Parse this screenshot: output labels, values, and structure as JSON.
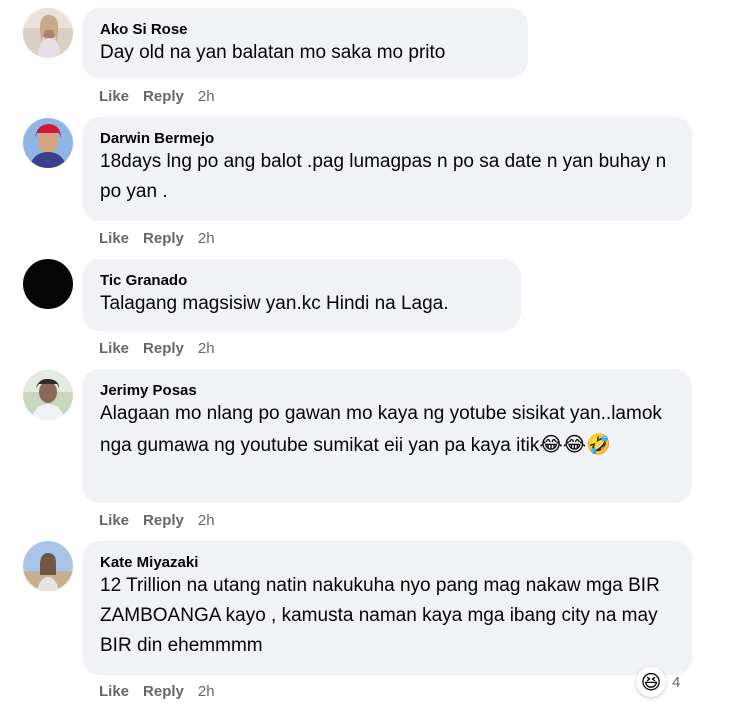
{
  "comments": [
    {
      "name": "Ako Si Rose",
      "text": "Day old na yan balatan mo saka mo prito",
      "like": "Like",
      "reply": "Reply",
      "time": "2h"
    },
    {
      "name": "Darwin Bermejo",
      "text": "18days lng po ang balot .pag lumagpas n po sa date n yan buhay n po yan .",
      "like": "Like",
      "reply": "Reply",
      "time": "2h"
    },
    {
      "name": "Tic Granado",
      "text": "Talagang magsisiw yan.kc Hindi na Laga.",
      "like": "Like",
      "reply": "Reply",
      "time": "2h"
    },
    {
      "name": "Jerimy Posas",
      "text": "Alagaan mo nlang po gawan mo kaya ng yotube sisikat yan..lamok nga gumawa ng youtube sumikat eii yan pa kaya itik",
      "emojis": "😂😂🤣",
      "like": "Like",
      "reply": "Reply",
      "time": "2h"
    },
    {
      "name": "Kate Miyazaki",
      "text": "12 Trillion na utang natin nakukuha nyo pang mag nakaw mga BIR ZAMBOANGA kayo , kamusta naman kaya mga ibang city na may BIR din ehemmmm",
      "like": "Like",
      "reply": "Reply",
      "time": "2h",
      "reaction": {
        "icon": "😆",
        "icon_name": "haha-reaction-icon",
        "count": "4"
      }
    }
  ],
  "colors": {
    "bubble": "#f0f2f5",
    "secondary_text": "#65676b",
    "primary_text": "#050505"
  }
}
